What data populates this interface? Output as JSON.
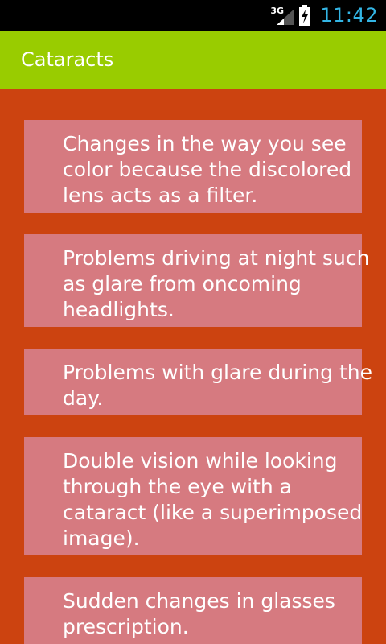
{
  "status_bar": {
    "network": "3G",
    "time": "11:42"
  },
  "action_bar": {
    "title": "Cataracts"
  },
  "symptoms": [
    {
      "lines": [
        "Changes in the way you see",
        "color because the discolored",
        "lens acts as a filter."
      ]
    },
    {
      "lines": [
        "Problems driving at night such",
        "as glare from oncoming",
        "headlights."
      ]
    },
    {
      "lines": [
        "Problems with glare during the",
        "day."
      ]
    },
    {
      "lines": [
        "Double vision while looking",
        "through the eye with a",
        "cataract (like a superimposed",
        "image)."
      ]
    },
    {
      "lines": [
        "Sudden changes in glasses",
        "prescription."
      ]
    }
  ],
  "colors": {
    "action_bar": "#99cc00",
    "background": "#cc4310",
    "card": "#d67a80",
    "clock": "#33b5e5"
  }
}
